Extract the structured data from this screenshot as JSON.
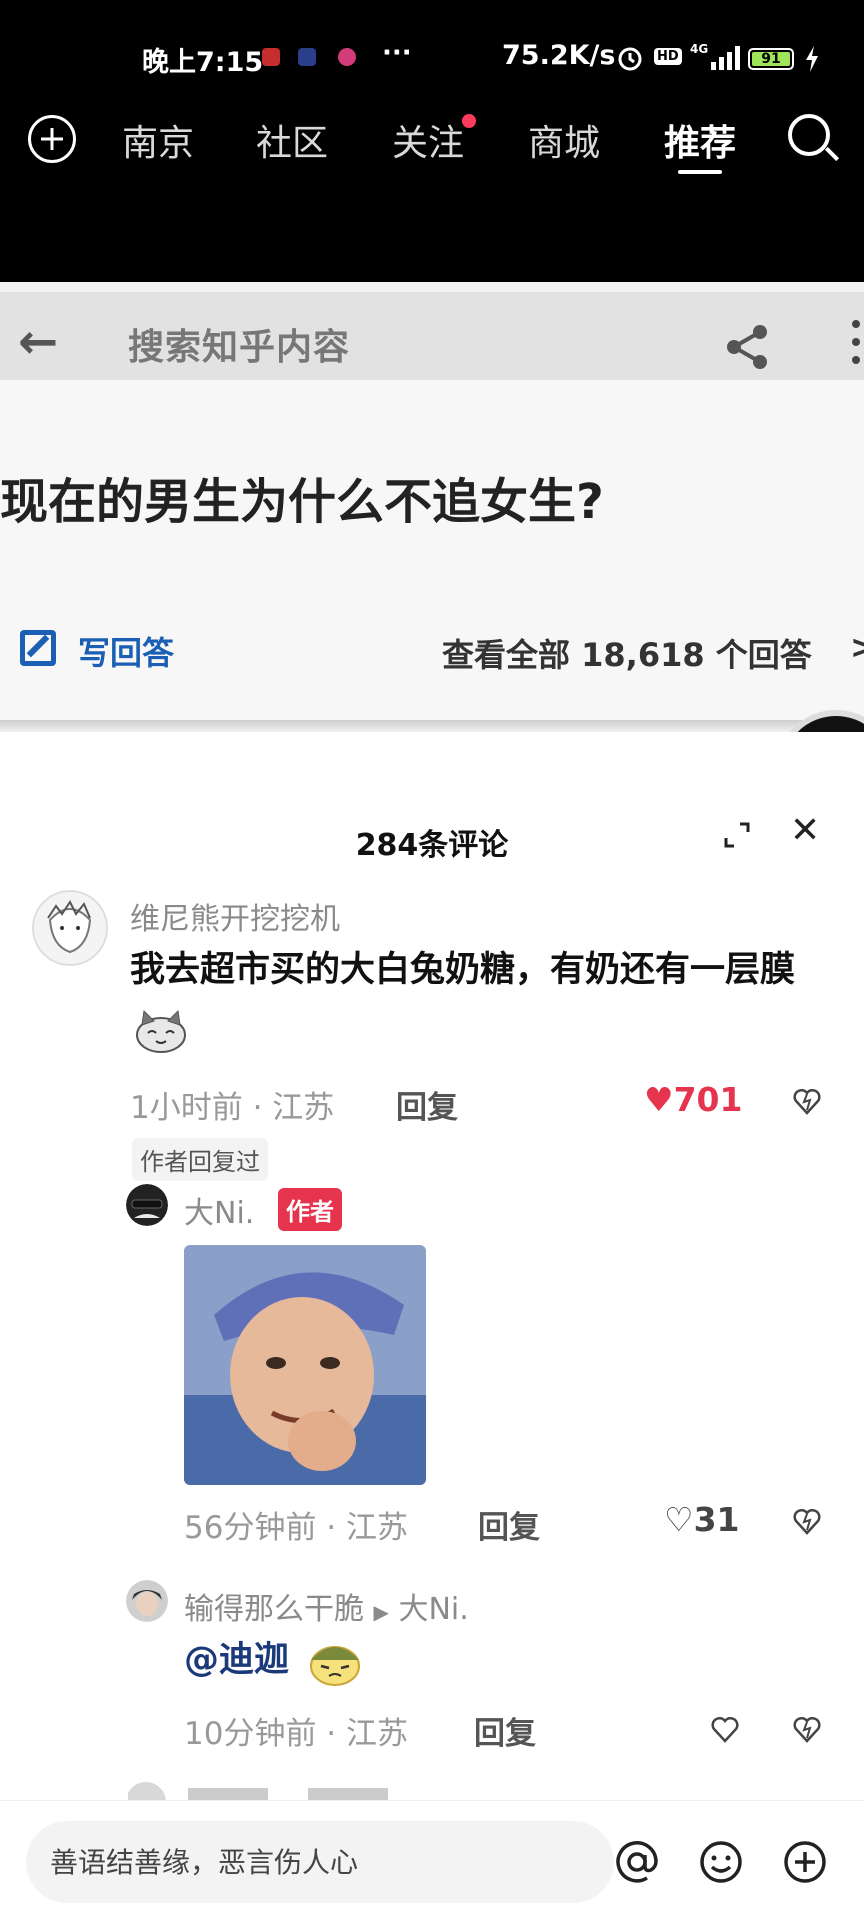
{
  "status_bar": {
    "time": "晚上7:15",
    "more": "···",
    "network_speed": "75.2K/s",
    "hd": "HD",
    "network": "4G",
    "battery": "91"
  },
  "top_nav": {
    "tabs": [
      {
        "label": "南京"
      },
      {
        "label": "社区"
      },
      {
        "label": "关注"
      },
      {
        "label": "商城"
      },
      {
        "label": "推荐"
      }
    ],
    "active_tab": "推荐"
  },
  "embedded_screenshot": {
    "search_placeholder": "搜索知乎内容",
    "question": "现在的男生为什么不追女生?",
    "write_answer": "写回答",
    "view_all": "查看全部 18,618 个回答",
    "chevron": ">"
  },
  "comments_panel": {
    "title": "284条评论",
    "comments": [
      {
        "username": "维尼熊开挖挖机",
        "text": "我去超市买的大白兔奶糖，有奶还有一层膜",
        "time": "1小时前",
        "location": "江苏",
        "reply_label": "回复",
        "likes": "701",
        "liked": true,
        "author_replied": "作者回复过"
      },
      {
        "username": "大Ni.",
        "author_tag": "作者",
        "time": "56分钟前",
        "location": "江苏",
        "reply_label": "回复",
        "likes": "31"
      },
      {
        "username": "输得那么干脆",
        "reply_to": "大Ni.",
        "text": "@迪迦",
        "time": "10分钟前",
        "location": "江苏",
        "reply_label": "回复",
        "likes": ""
      }
    ]
  },
  "comment_input": {
    "placeholder": "善语结善缘，恶言伤人心"
  },
  "colors": {
    "like_red": "#e6334e",
    "author_tag": "#e6334e",
    "zhihu_blue": "#1a5fb4"
  }
}
